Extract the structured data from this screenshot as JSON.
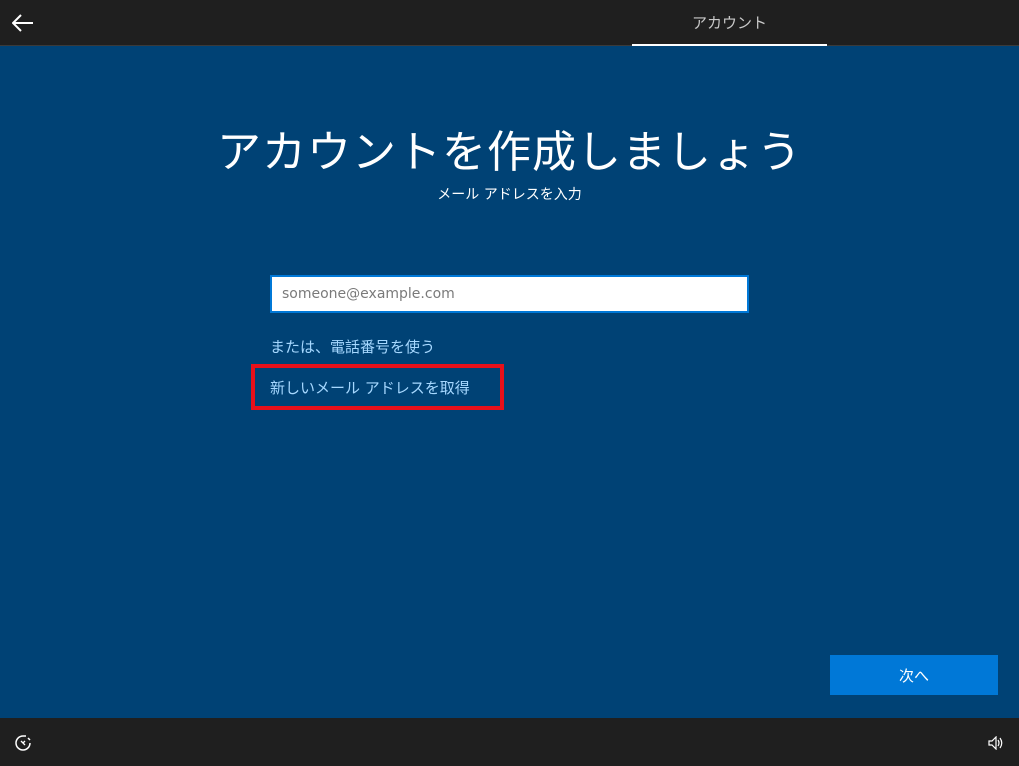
{
  "header": {
    "tab_label": "アカウント",
    "back_icon": "back-arrow-icon"
  },
  "main": {
    "title": "アカウントを作成しましょう",
    "subtitle": "メール アドレスを入力",
    "email_input": {
      "placeholder": "someone@example.com",
      "value": ""
    },
    "phone_link": "または、電話番号を使う",
    "new_email_link": "新しいメール アドレスを取得",
    "next_button": "次へ"
  },
  "footer": {
    "ease_of_access_icon": "ease-of-access-icon",
    "volume_icon": "volume-icon"
  },
  "colors": {
    "background": "#004275",
    "bar": "#1f1f1f",
    "accent": "#0078d7",
    "link": "#a6d8ff",
    "highlight_box": "#e8101a"
  }
}
